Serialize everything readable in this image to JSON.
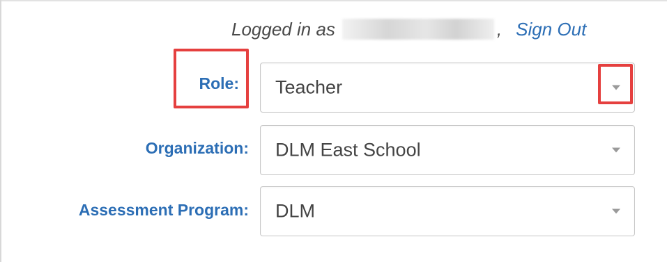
{
  "header": {
    "logged_in_prefix": "Logged in as",
    "username_redacted": "",
    "comma": ",",
    "sign_out_label": "Sign Out"
  },
  "form": {
    "role": {
      "label": "Role:",
      "value": "Teacher"
    },
    "organization": {
      "label": "Organization:",
      "value": "DLM East School"
    },
    "assessment_program": {
      "label": "Assessment Program:",
      "value": "DLM"
    }
  },
  "colors": {
    "label_blue": "#2c6eb5",
    "highlight_red": "#e5403f",
    "text_gray": "#444444"
  },
  "icons": {
    "dropdown": "chevron-down-icon"
  }
}
